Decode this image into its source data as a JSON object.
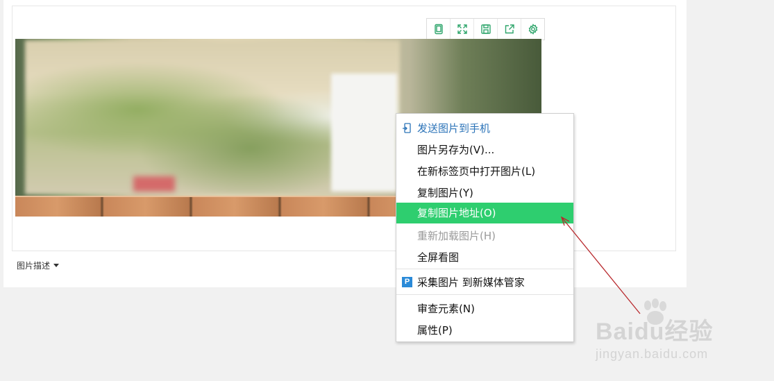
{
  "toolbar": {
    "buttons": [
      {
        "name": "phone-icon"
      },
      {
        "name": "fullscreen-icon"
      },
      {
        "name": "save-icon"
      },
      {
        "name": "share-icon"
      },
      {
        "name": "gear-icon"
      }
    ],
    "color": "#2ea56b"
  },
  "caption": {
    "label": "图片描述"
  },
  "context_menu": {
    "items": [
      {
        "label": "发送图片到手机",
        "style": "link",
        "icon": "send-to-phone-icon"
      },
      {
        "label": "图片另存为(V)..."
      },
      {
        "label": "在新标签页中打开图片(L)"
      },
      {
        "label": "复制图片(Y)"
      },
      {
        "label": "复制图片地址(O)",
        "highlighted": true
      },
      {
        "label": "重新加载图片(H)",
        "disabled": true
      },
      {
        "label": "全屏看图"
      },
      {
        "label": "采集图片 到新媒体管家",
        "icon": "p-icon",
        "icon_text": "P"
      },
      {
        "label": "审查元素(N)"
      },
      {
        "label": "属性(P)"
      }
    ],
    "highlight_color": "#2ece6f"
  },
  "watermark": {
    "logo": "Baidu经验",
    "url": "jingyan.baidu.com"
  }
}
